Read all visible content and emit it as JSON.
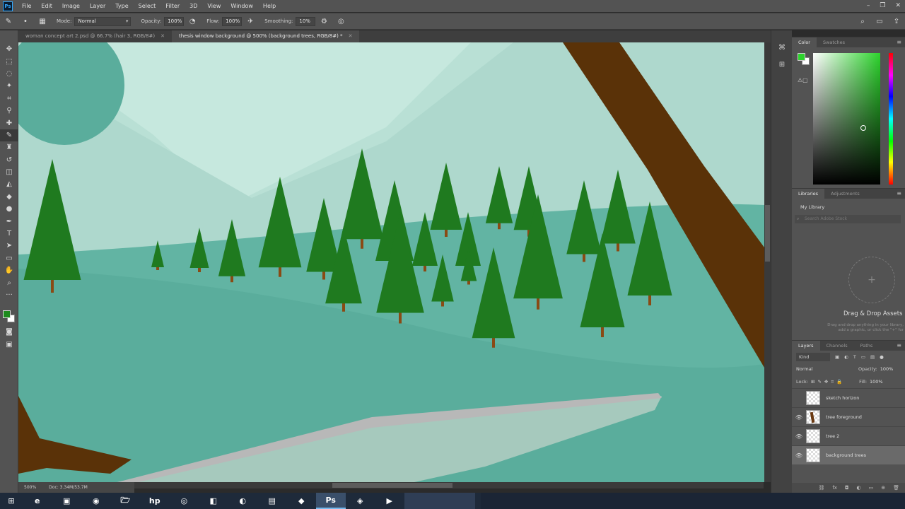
{
  "app": {
    "logo": "Ps",
    "menu": [
      "File",
      "Edit",
      "Image",
      "Layer",
      "Type",
      "Select",
      "Filter",
      "3D",
      "View",
      "Window",
      "Help"
    ],
    "window_controls": [
      "–",
      "❐",
      "✕"
    ]
  },
  "options_bar": {
    "mode_label": "Mode:",
    "mode_value": "Normal",
    "opacity_label": "Opacity:",
    "opacity_value": "100%",
    "flow_label": "Flow:",
    "flow_value": "100%",
    "smoothing_label": "Smoothing:",
    "smoothing_value": "10%"
  },
  "tabs": [
    {
      "label": "woman concept art 2.psd @ 66.7% (hair 3, RGB/8#)",
      "active": false
    },
    {
      "label": "thesis window background @ 500% (background trees, RGB/8#) *",
      "active": true
    }
  ],
  "status": {
    "zoom": "500%",
    "doc": "Doc: 3.34M/53.7M"
  },
  "color_panel": {
    "tabs": [
      "Color",
      "Swatches"
    ],
    "foreground_color": "#2cd32c",
    "background_color": "#ffffff"
  },
  "libraries_panel": {
    "tabs": [
      "Libraries",
      "Adjustments"
    ],
    "library_name": "My Library",
    "search_placeholder": "Search Adobe Stock",
    "drop_title": "Drag & Drop Assets",
    "drop_hint": "Drag and drop anything in your library, add a graphic, or click the \"+\" for"
  },
  "layers_panel": {
    "tabs": [
      "Layers",
      "Channels",
      "Paths"
    ],
    "kind_label": "Kind",
    "blend_mode": "Normal",
    "opacity_label": "Opacity:",
    "opacity_value": "100%",
    "lock_label": "Lock:",
    "fill_label": "Fill:",
    "fill_value": "100%",
    "layers": [
      {
        "name": "sketch horizon",
        "visible": false,
        "active": false,
        "thumb": "plain"
      },
      {
        "name": "tree foreground",
        "visible": true,
        "active": false,
        "thumb": "fg"
      },
      {
        "name": "tree 2",
        "visible": true,
        "active": false,
        "thumb": "plain"
      },
      {
        "name": "background trees",
        "visible": true,
        "active": true,
        "thumb": "plain"
      }
    ]
  },
  "taskbar": {
    "apps": [
      "e",
      "▣",
      "◉",
      "🗁",
      "hp",
      "◎",
      "◧",
      "◐",
      "▤",
      "◆",
      "Ps",
      "◈",
      "▶"
    ],
    "active_index": 10
  },
  "canvas_colors": {
    "sky": "#b9e0d5",
    "sky_far": "#c6e8de",
    "hill_back": "#aed8cd",
    "ground_mid": "#62b4a3",
    "ground_front": "#5aad9c",
    "road": "#a6c9bd",
    "trunk": "#5a3208",
    "tree_green": "#1f7a1f"
  }
}
